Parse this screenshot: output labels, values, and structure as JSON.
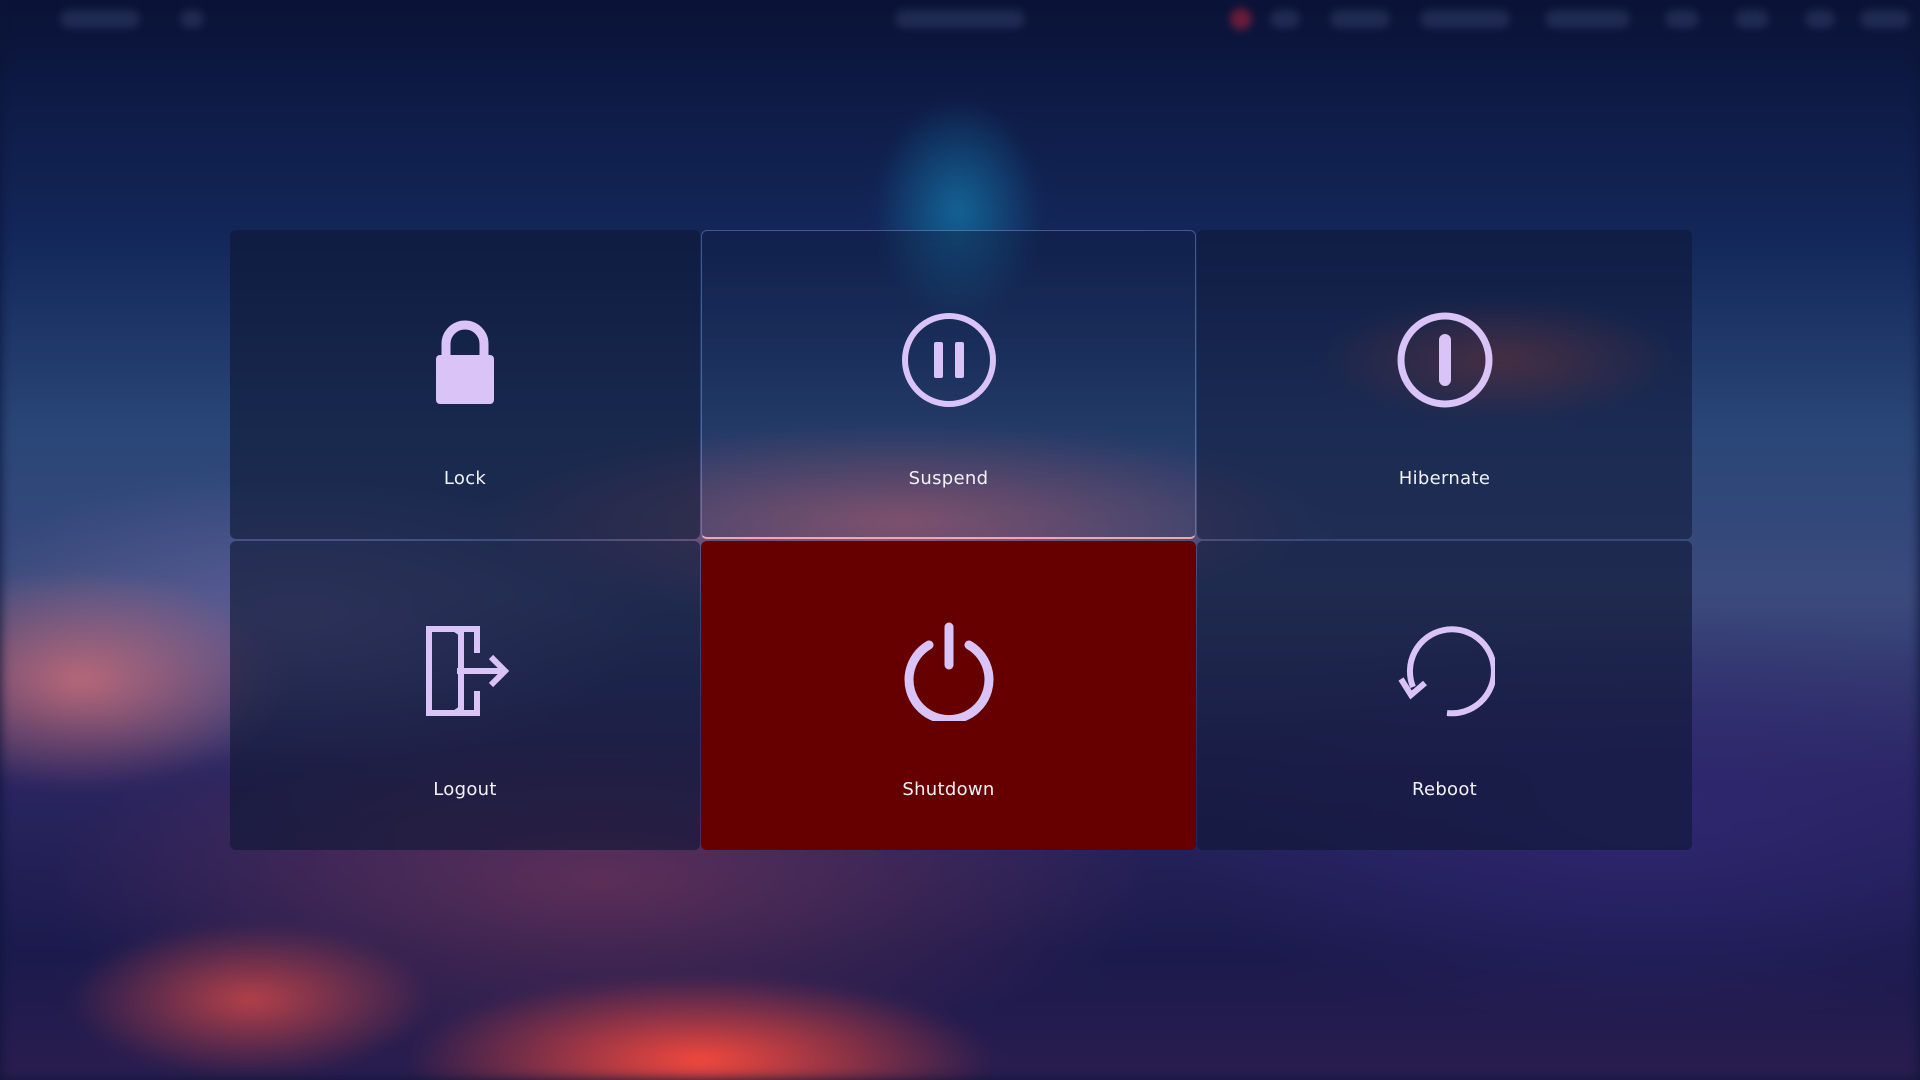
{
  "colors": {
    "icon": "#d9c3f7",
    "selected_tile": "#660000",
    "label": "#f2f2f6"
  },
  "power_menu": {
    "selected": "Shutdown",
    "options": [
      {
        "id": "lock",
        "label": "Lock",
        "icon": "lock-icon"
      },
      {
        "id": "suspend",
        "label": "Suspend",
        "icon": "pause-circle-icon"
      },
      {
        "id": "hibernate",
        "label": "Hibernate",
        "icon": "hibernate-icon"
      },
      {
        "id": "logout",
        "label": "Logout",
        "icon": "logout-icon"
      },
      {
        "id": "shutdown",
        "label": "Shutdown",
        "icon": "power-icon"
      },
      {
        "id": "reboot",
        "label": "Reboot",
        "icon": "reboot-icon"
      }
    ]
  }
}
